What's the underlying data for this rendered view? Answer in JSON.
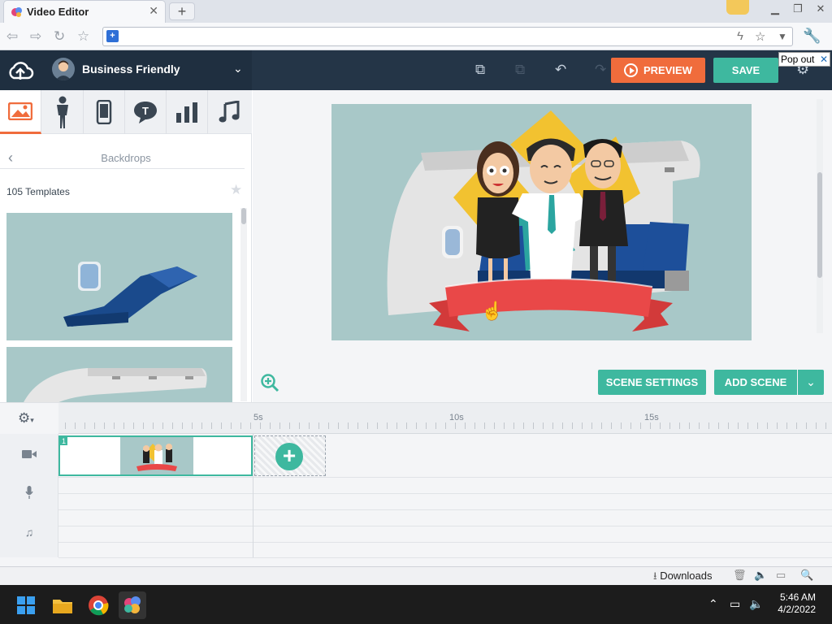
{
  "browser": {
    "tab_title": "Video Editor",
    "new_tab": "+",
    "close_tab": "✕",
    "url": ""
  },
  "header": {
    "theme_name": "Business Friendly",
    "preview_label": "PREVIEW",
    "save_label": "SAVE",
    "popout_label": "Pop out",
    "popout_close": "✕"
  },
  "left_panel": {
    "section_title": "Backdrops",
    "template_count": "105 Templates",
    "categories": [
      "image",
      "character",
      "device",
      "text",
      "chart",
      "music"
    ]
  },
  "canvas": {
    "scene_settings_label": "SCENE SETTINGS",
    "add_scene_label": "ADD SCENE"
  },
  "timeline": {
    "ticks": [
      "5s",
      "10s",
      "15s"
    ],
    "clip_number": "1",
    "tracks": [
      "video",
      "voice",
      "music"
    ]
  },
  "statusbar": {
    "downloads_label": "Downloads"
  },
  "taskbar": {
    "time": "5:46 AM",
    "date": "4/2/2022"
  },
  "colors": {
    "accent_green": "#3eb89f",
    "accent_orange": "#f06c3c",
    "header_bg": "#243547"
  }
}
